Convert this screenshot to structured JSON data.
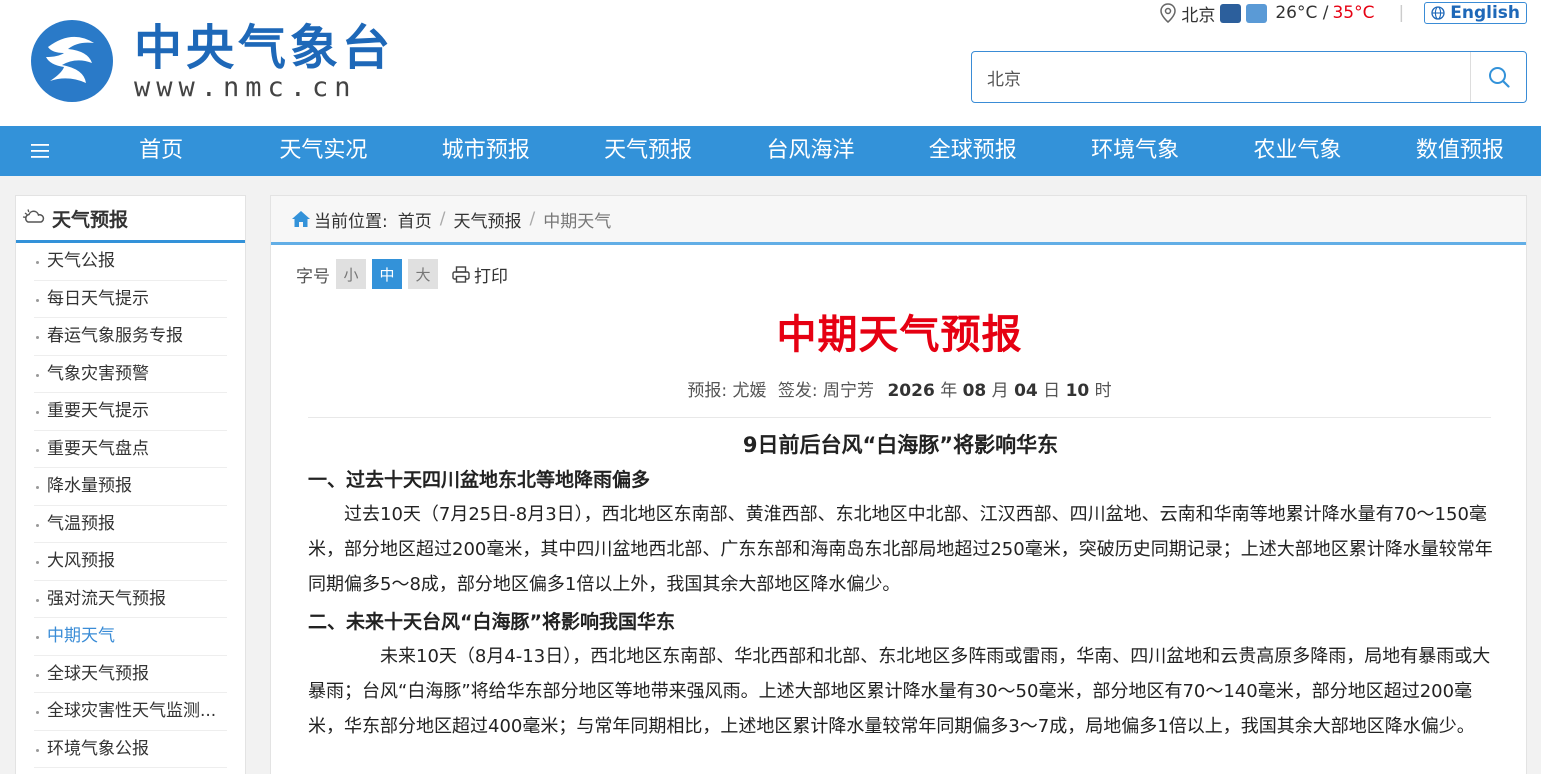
{
  "site": {
    "name_cn": "中央气象台",
    "name_en": "www.nmc.cn"
  },
  "topbar": {
    "city": "北京",
    "temp_low": "26°C /",
    "temp_high": "35°C",
    "weather_icons": [
      "rain-icon",
      "cloudy-icon"
    ],
    "english_label": "English"
  },
  "search": {
    "value": "北京"
  },
  "nav": {
    "items": [
      "首页",
      "天气实况",
      "城市预报",
      "天气预报",
      "台风海洋",
      "全球预报",
      "环境气象",
      "农业气象",
      "数值预报"
    ]
  },
  "sidebar": {
    "title": "天气预报",
    "items": [
      "天气公报",
      "每日天气提示",
      "春运气象服务专报",
      "气象灾害预警",
      "重要天气提示",
      "重要天气盘点",
      "降水量预报",
      "气温预报",
      "大风预报",
      "强对流天气预报",
      "中期天气",
      "全球天气预报",
      "全球灾害性天气监测...",
      "环境气象公报"
    ],
    "active_index": 10
  },
  "breadcrumb": {
    "label": "当前位置:",
    "home": "首页",
    "parent": "天气预报",
    "current": "中期天气"
  },
  "tools": {
    "font_label": "字号",
    "small": "小",
    "medium": "中",
    "large": "大",
    "print": "打印"
  },
  "article": {
    "title": "中期天气预报",
    "byline": {
      "forecaster_label": "预报:",
      "forecaster": "尤媛",
      "issuer_label": "签发:",
      "issuer": "周宁芳",
      "year": "2026",
      "year_unit": "年",
      "month": "08",
      "month_unit": "月",
      "day": "04",
      "day_unit": "日",
      "hour": "10",
      "hour_unit": "时"
    },
    "headline": "9日前后台风“白海豚”将影响华东",
    "section1_title": "一、过去十天四川盆地东北等地降雨偏多",
    "section1_body": "过去10天（7月25日-8月3日），西北地区东南部、黄淮西部、东北地区中北部、江汉西部、四川盆地、云南和华南等地累计降水量有70～150毫米，部分地区超过200毫米，其中四川盆地西北部、广东东部和海南岛东北部局地超过250毫米，突破历史同期记录；上述大部地区累计降水量较常年同期偏多5～8成，部分地区偏多1倍以上外，我国其余大部地区降水偏少。",
    "section2_title": "二、未来十天台风“白海豚”将影响我国华东",
    "section2_body": "未来10天（8月4-13日），西北地区东南部、华北西部和北部、东北地区多阵雨或雷雨，华南、四川盆地和云贵高原多降雨，局地有暴雨或大暴雨；台风“白海豚”将给华东部分地区等地带来强风雨。上述大部地区累计降水量有30～50毫米，部分地区有70～140毫米，部分地区超过200毫米，华东部分地区超过400毫米；与常年同期相比，上述地区累计降水量较常年同期偏多3～7成，局地偏多1倍以上，我国其余大部地区降水偏少。"
  }
}
